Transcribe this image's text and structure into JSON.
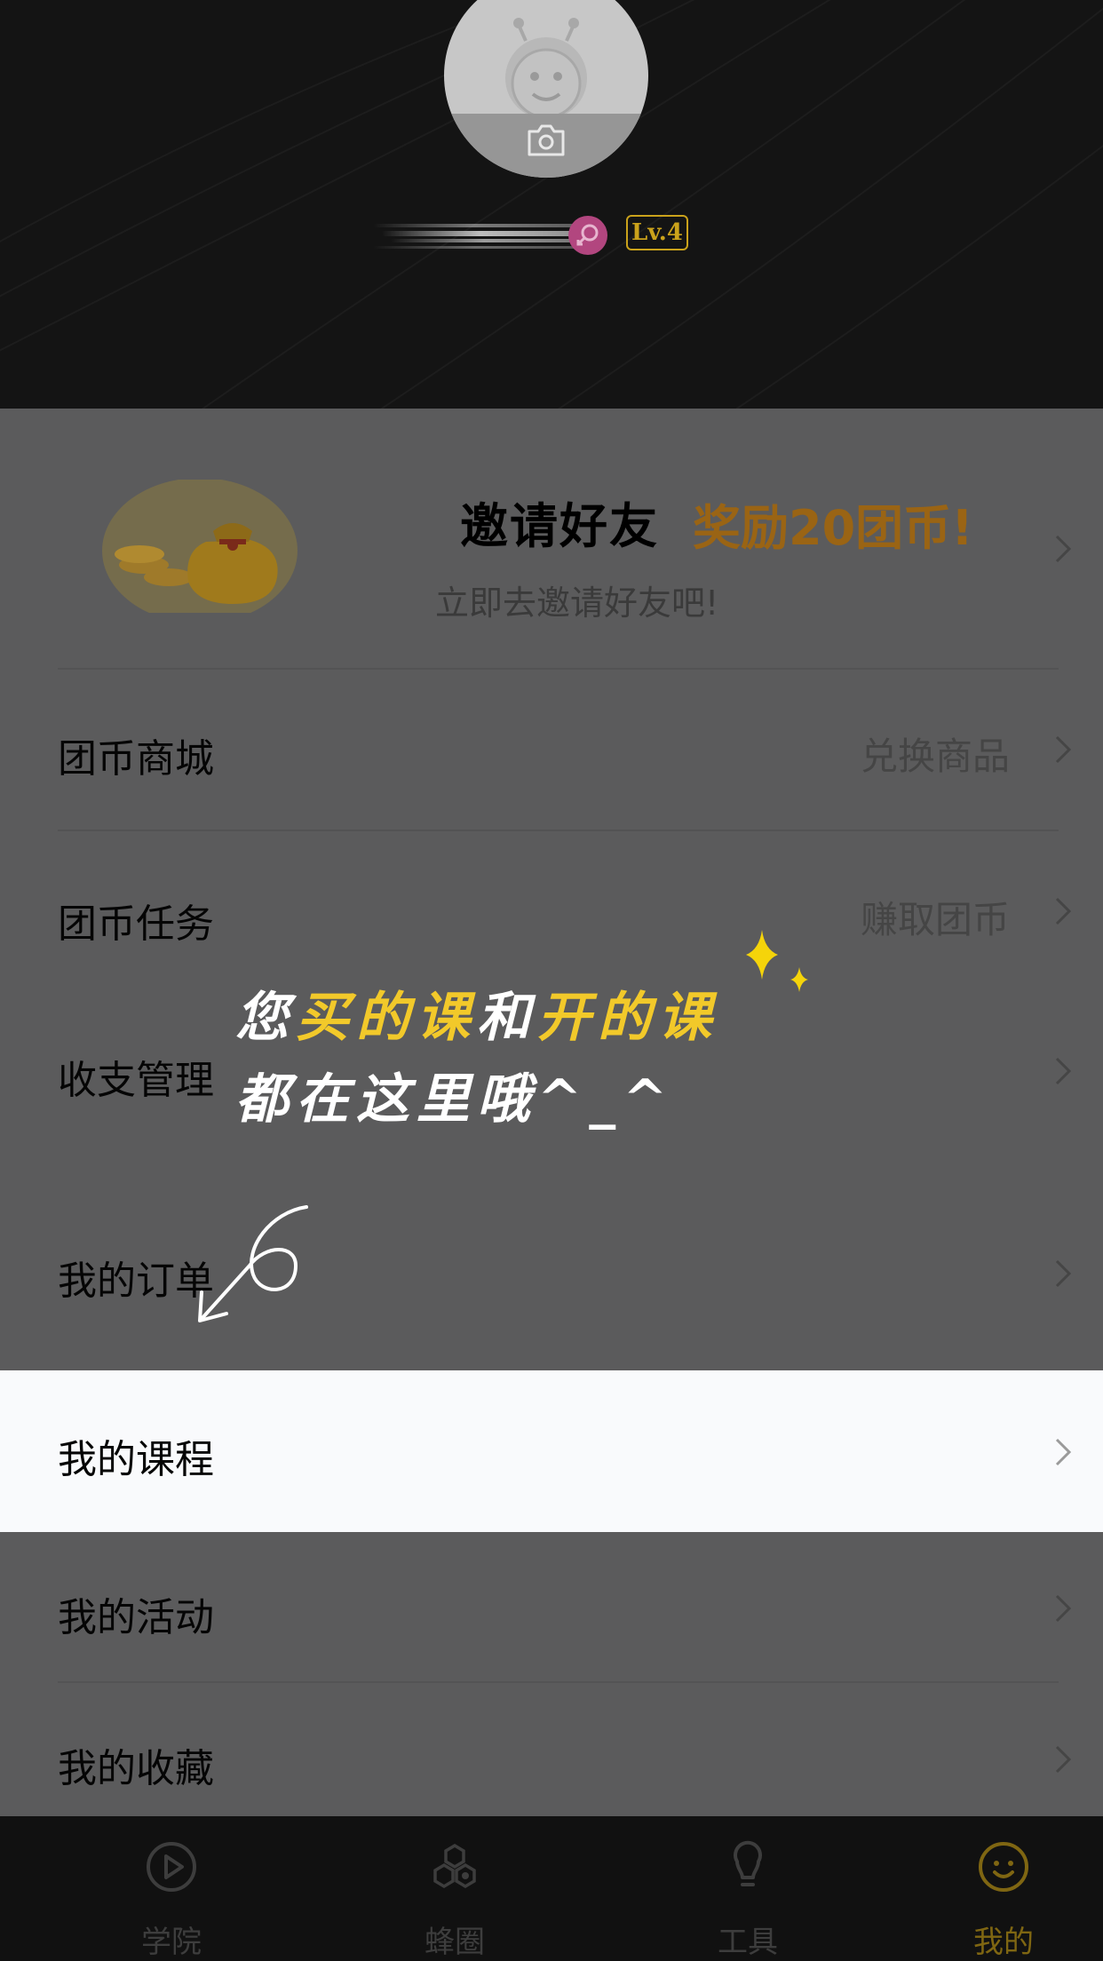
{
  "profile": {
    "level": "Lv.4"
  },
  "invite": {
    "title": "邀请好友",
    "reward": "奖励20团币!",
    "subtitle": "立即去邀请好友吧!"
  },
  "menu": {
    "items": [
      {
        "label": "团币商城",
        "value": "兑换商品"
      },
      {
        "label": "团币任务",
        "value": "赚取团币"
      },
      {
        "label": "收支管理",
        "value": ""
      },
      {
        "label": "我的订单",
        "value": ""
      },
      {
        "label": "我的课程",
        "value": ""
      },
      {
        "label": "我的活动",
        "value": ""
      },
      {
        "label": "我的收藏",
        "value": ""
      }
    ]
  },
  "tip": {
    "line1_a": "您",
    "line1_b": "买的课",
    "line1_c": "和",
    "line1_d": "开的课",
    "line2": "都在这里哦^_^"
  },
  "tabbar": {
    "tabs": [
      {
        "label": "学院",
        "icon": "play-icon"
      },
      {
        "label": "蜂圈",
        "icon": "hexagons-icon"
      },
      {
        "label": "工具",
        "icon": "lightbulb-icon"
      },
      {
        "label": "我的",
        "icon": "smiley-icon"
      }
    ],
    "active_color": "#7f6612"
  },
  "colors": {
    "accent": "#caa21b",
    "reward": "#9a6414",
    "overlay": "#5b5b5c"
  }
}
